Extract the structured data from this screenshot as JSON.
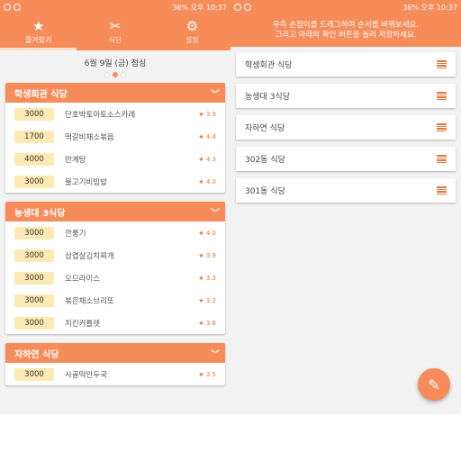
{
  "status_left": {
    "time": "오후 10:37",
    "battery": "36%"
  },
  "status_right": {
    "time": "오후 10:37",
    "battery": "36%"
  },
  "tabs": [
    {
      "label": "즐겨찾기",
      "icon": "star-icon"
    },
    {
      "label": "식단",
      "icon": "utensils-icon"
    },
    {
      "label": "설정",
      "icon": "gear-icon"
    }
  ],
  "date_label": "6월 9일 (금) 점심",
  "cards": [
    {
      "title": "학생회관 식당",
      "items": [
        {
          "price": "3000",
          "name": "단호박토마토소스카레",
          "rating": "★ 3.9"
        },
        {
          "price": "1700",
          "name": "떡갈비채소볶음",
          "rating": "★ 4.4"
        },
        {
          "price": "4000",
          "name": "반계탕",
          "rating": "★ 4.3"
        },
        {
          "price": "3000",
          "name": "불고기비빔밥",
          "rating": "★ 4.0"
        }
      ]
    },
    {
      "title": "농생대 3식당",
      "items": [
        {
          "price": "3000",
          "name": "깐풍기",
          "rating": "★ 4.0"
        },
        {
          "price": "3000",
          "name": "삼겹살김치찌개",
          "rating": "★ 3.9"
        },
        {
          "price": "3000",
          "name": "오므라이스",
          "rating": "★ 3.3"
        },
        {
          "price": "3000",
          "name": "볶은채소브리또",
          "rating": "★ 3.2"
        },
        {
          "price": "3000",
          "name": "치킨커틀렛",
          "rating": "★ 3.6"
        }
      ]
    },
    {
      "title": "자하연 식당",
      "items": [
        {
          "price": "3000",
          "name": "사골떡만두국",
          "rating": "★ 3.5"
        }
      ]
    }
  ],
  "hint_lines": [
    "우측 손잡이를 드래그하여 순서를 바꿔보세요.",
    "그리고 아래의 확인 버튼을 눌러 저장하세요."
  ],
  "order_list": [
    "학생회관 식당",
    "농생대 3식당",
    "자하연 식당",
    "302동 식당",
    "301동 식당"
  ],
  "fab": {
    "icon": "pencil-icon"
  },
  "accent_color": "#f58c5a"
}
